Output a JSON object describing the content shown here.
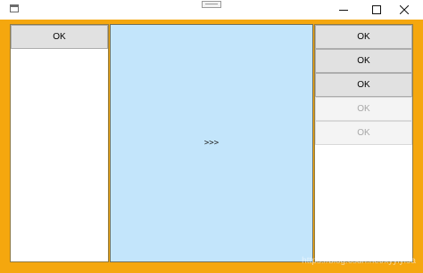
{
  "window": {
    "icon": "app-window-icon",
    "caption_buttons": {
      "minimize_icon": "minimize-icon",
      "maximize_icon": "maximize-icon",
      "close_icon": "close-icon"
    }
  },
  "colors": {
    "frame": "#f5a70e",
    "center_panel": "#c3e5fb",
    "button_face": "#e1e1e1",
    "button_disabled_face": "#f4f4f4",
    "button_disabled_text": "#a8a8a8"
  },
  "left_panel": {
    "button_label": "OK"
  },
  "center_panel": {
    "label": ">>>"
  },
  "right_panel": {
    "buttons": [
      {
        "label": "OK",
        "enabled": true
      },
      {
        "label": "OK",
        "enabled": true
      },
      {
        "label": "OK",
        "enabled": true
      },
      {
        "label": "OK",
        "enabled": false
      },
      {
        "label": "OK",
        "enabled": false
      }
    ]
  },
  "watermark": "https://blog.csdn.net/xyyiyi9a"
}
